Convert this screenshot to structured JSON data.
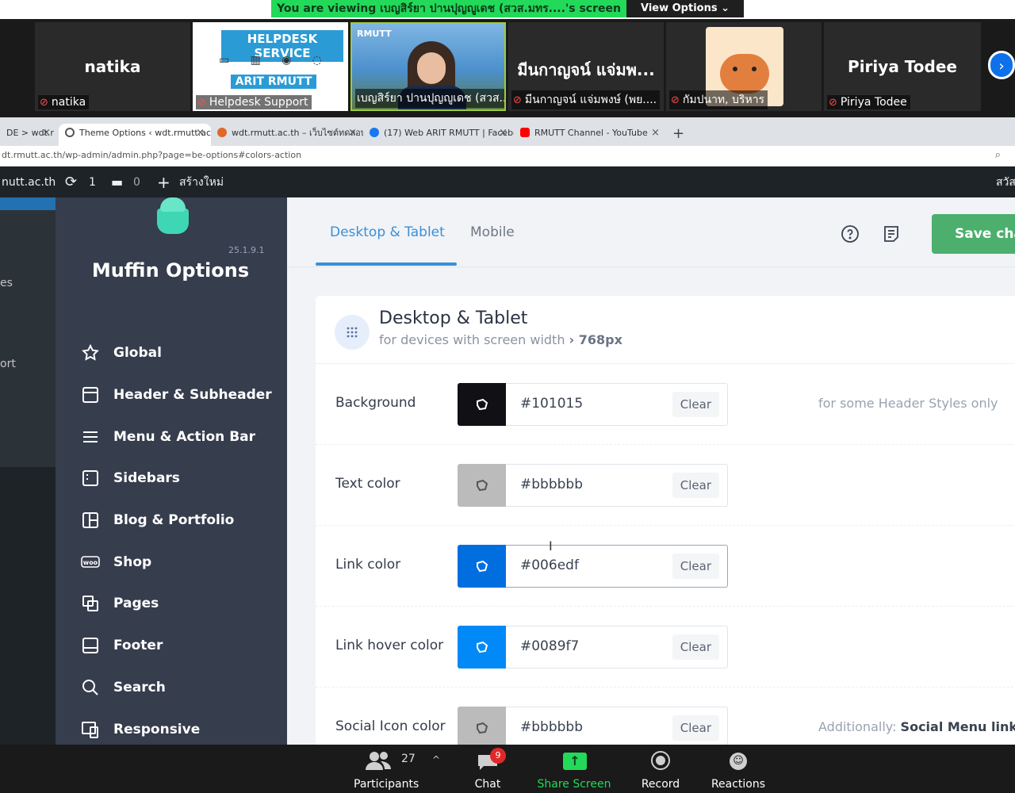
{
  "zoom": {
    "banner": "You are viewing เบญสิร์ยา ปานปุญญูเดช (สวส.มทร....'s screen",
    "view_options": "View Options ⌄",
    "tiles": [
      {
        "big": "natika",
        "small": "natika"
      },
      {
        "big": "",
        "small": "Helpdesk Support"
      },
      {
        "big": "",
        "small": "เบญสิร์ยา ปานปุญญูเดช (สวส...."
      },
      {
        "big": "มีนกาญจน์ แจ่มพ...",
        "small": "มีนกาญจน์ แจ่มพงษ์ (พย...."
      },
      {
        "big": "",
        "small": "กัมปนาท, บริหาร"
      },
      {
        "big": "Piriya Todee",
        "small": "Piriya Todee"
      }
    ],
    "helpdesk": {
      "title": "HELPDESK SERVICE",
      "sub": "ARIT RMUTT"
    },
    "speaker_logo": "RMUTT",
    "toolbar": {
      "participants": "Participants",
      "participants_count": "27",
      "chat": "Chat",
      "chat_badge": "9",
      "share": "Share Screen",
      "record": "Record",
      "reactions": "Reactions"
    }
  },
  "browser": {
    "tabs": [
      {
        "label": "DE > wdt.r",
        "active": false
      },
      {
        "label": "Theme Options ‹ wdt.rmutt.ac.th",
        "active": true
      },
      {
        "label": "wdt.rmutt.ac.th – เว็บไซต์ทดลอบระ",
        "active": false
      },
      {
        "label": "(17) Web ARIT RMUTT | Faceboo",
        "active": false
      },
      {
        "label": "RMUTT Channel - YouTube",
        "active": false
      }
    ],
    "url": "dt.rmutt.ac.th/wp-admin/admin.php?page=be-options#colors-action"
  },
  "wpbar": {
    "site": "nutt.ac.th",
    "updates": "1",
    "comments": "0",
    "new": "สร้างใหม่",
    "greeting": "สวัส"
  },
  "wpside": [
    "es",
    "ort"
  ],
  "muffin": {
    "version": "25.1.9.1",
    "title": "Muffin Options",
    "nav": [
      {
        "label": "Global",
        "icon": "star-icon"
      },
      {
        "label": "Header & Subheader",
        "icon": "header-icon"
      },
      {
        "label": "Menu & Action Bar",
        "icon": "menu-icon"
      },
      {
        "label": "Sidebars",
        "icon": "sidebar-icon"
      },
      {
        "label": "Blog & Portfolio",
        "icon": "blog-icon"
      },
      {
        "label": "Shop",
        "icon": "woo-icon"
      },
      {
        "label": "Pages",
        "icon": "pages-icon"
      },
      {
        "label": "Footer",
        "icon": "footer-icon"
      },
      {
        "label": "Search",
        "icon": "search-icon"
      },
      {
        "label": "Responsive",
        "icon": "responsive-icon"
      }
    ]
  },
  "main": {
    "tab_desktop": "Desktop & Tablet",
    "tab_mobile": "Mobile",
    "save": "Save changes",
    "card_title": "Desktop & Tablet",
    "card_sub_prefix": "for devices with screen width ",
    "card_sub_bold": "› 768px",
    "clear": "Clear",
    "rows": [
      {
        "label": "Background",
        "hex": "#101015",
        "note": "for some Header Styles only",
        "note_bold": "",
        "swatch": "#101015"
      },
      {
        "label": "Text color",
        "hex": "#bbbbbb",
        "note": "",
        "note_bold": "",
        "swatch": "#bbbbbb"
      },
      {
        "label": "Link color",
        "hex": "#006edf",
        "note": "",
        "note_bold": "",
        "swatch": "#006edf"
      },
      {
        "label": "Link hover color",
        "hex": "#0089f7",
        "note": "",
        "note_bold": "",
        "swatch": "#0089f7"
      },
      {
        "label": "Social Icon color",
        "hex": "#bbbbbb",
        "note": "Additionally: ",
        "note_bold": "Social Menu link co",
        "swatch": "#bbbbbb"
      }
    ]
  }
}
